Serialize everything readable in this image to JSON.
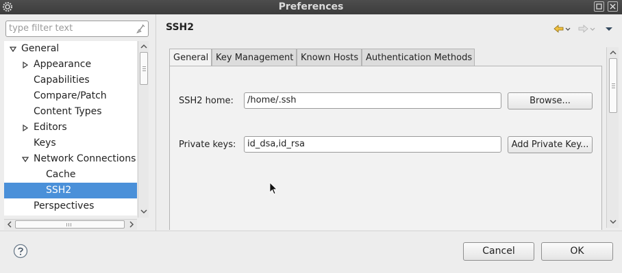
{
  "window": {
    "title": "Preferences"
  },
  "filter": {
    "placeholder": "type filter text"
  },
  "tree": {
    "items": [
      {
        "label": "General",
        "level": 0,
        "expander": "expanded"
      },
      {
        "label": "Appearance",
        "level": 1,
        "expander": "collapsed"
      },
      {
        "label": "Capabilities",
        "level": 1,
        "expander": "none"
      },
      {
        "label": "Compare/Patch",
        "level": 1,
        "expander": "none"
      },
      {
        "label": "Content Types",
        "level": 1,
        "expander": "none"
      },
      {
        "label": "Editors",
        "level": 1,
        "expander": "collapsed"
      },
      {
        "label": "Keys",
        "level": 1,
        "expander": "none"
      },
      {
        "label": "Network Connections",
        "level": 1,
        "expander": "expanded"
      },
      {
        "label": "Cache",
        "level": 2,
        "expander": "none"
      },
      {
        "label": "SSH2",
        "level": 2,
        "expander": "none",
        "selected": true
      },
      {
        "label": "Perspectives",
        "level": 1,
        "expander": "none"
      }
    ]
  },
  "page": {
    "title": "SSH2"
  },
  "tabs": [
    {
      "label": "General",
      "active": true
    },
    {
      "label": "Key Management",
      "active": false
    },
    {
      "label": "Known Hosts",
      "active": false
    },
    {
      "label": "Authentication Methods",
      "active": false
    }
  ],
  "general": {
    "ssh2_home_label": "SSH2 home:",
    "ssh2_home_value": "/home/.ssh",
    "browse_label": "Browse...",
    "private_keys_label": "Private keys:",
    "private_keys_value": "id_dsa,id_rsa",
    "add_key_label": "Add Private Key..."
  },
  "dialog": {
    "cancel_label": "Cancel",
    "ok_label": "OK"
  },
  "colors": {
    "titlebar": "#3c3c3c",
    "selection": "#4a90d9"
  }
}
